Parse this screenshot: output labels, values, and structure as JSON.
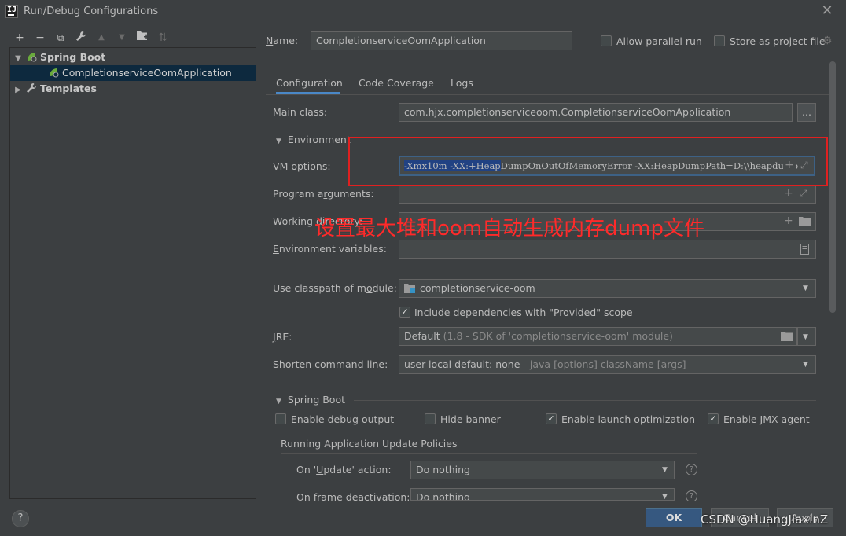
{
  "window": {
    "title": "Run/Debug Configurations",
    "app_icon_text": "IJ"
  },
  "toolbar": {
    "add": "+",
    "remove": "−",
    "copy": "⧉",
    "edit": "🔧",
    "up": "▲",
    "down": "▼",
    "folder": "▣",
    "sort": "⇅"
  },
  "tree": {
    "spring_boot": "Spring Boot",
    "app": "CompletionserviceOomApplication",
    "templates": "Templates"
  },
  "header": {
    "name_label_prefix": "N",
    "name_label_rest": "ame:",
    "name_value": "CompletionserviceOomApplication",
    "parallel_label_a": "Allow parallel r",
    "parallel_label_u": "u",
    "parallel_label_b": "n",
    "store_label_a": "S",
    "store_label_b": "tore as project file"
  },
  "tabs": [
    {
      "label": "Configuration"
    },
    {
      "label": "Code Coverage"
    },
    {
      "label": "Logs"
    }
  ],
  "config": {
    "main_class_label": "Main class:",
    "main_class_value": "com.hjx.completionserviceoom.CompletionserviceOomApplication",
    "browse_button": "...",
    "environment_section": "Environment",
    "vm_label_a": "V",
    "vm_label_b": "M options:",
    "vm_value_selected": "-Xmx10m -XX:+Heap",
    "vm_value_rest": "DumpOnOutOfMemoryError -XX:HeapDumpPath=D:\\\\heapdump",
    "program_args_label_a": "Program a",
    "program_args_label_u": "r",
    "program_args_label_b": "guments:",
    "working_dir_label_a": "W",
    "working_dir_label_b": "orking directory:",
    "env_vars_label_a": "E",
    "env_vars_label_b": "nvironment variables:",
    "classpath_label_a": "Use classpath of m",
    "classpath_label_u": "o",
    "classpath_label_b": "dule:",
    "classpath_value": "completionservice-oom",
    "include_deps_label": "Include dependencies with \"Provided\" scope",
    "jre_label_a": "J",
    "jre_label_b": "RE:",
    "jre_value_main": "Default",
    "jre_value_detail": "(1.8 - SDK of 'completionservice-oom' module)",
    "shorten_label_a": "Shorten command ",
    "shorten_label_u": "l",
    "shorten_label_b": "ine:",
    "shorten_value_main": "user-local default: none",
    "shorten_value_detail": "- java [options] className [args]"
  },
  "spring_boot": {
    "section": "Spring Boot",
    "debug_output_a": "Enable ",
    "debug_output_u": "d",
    "debug_output_b": "ebug output",
    "hide_banner_a": "H",
    "hide_banner_b": "ide banner",
    "launch_opt": "Enable launch optimization",
    "jmx": "Enable JMX agent",
    "policies_title": "Running Application Update Policies",
    "on_update_label_a": "On '",
    "on_update_label_u": "U",
    "on_update_label_b": "pdate' action:",
    "on_update_value": "Do nothing",
    "on_frame_label": "On frame deactivation:",
    "on_frame_value": "Do nothing"
  },
  "state": {
    "allow_parallel": false,
    "store_as_file": false,
    "include_deps": true,
    "debug_output": false,
    "hide_banner": false,
    "launch_optimization": true,
    "jmx_agent": true
  },
  "annotation": {
    "text": "设置最大堆和oom自动生成内存dump文件",
    "color": "#ff2a2a"
  },
  "footer": {
    "ok": "OK",
    "cancel": "Cancel",
    "apply": "Apply",
    "help": "?"
  },
  "watermark": "CSDN @HuangJiaxinZ",
  "colors": {
    "background": "#3c3f41",
    "selection": "#0d293e",
    "accent": "#4a88c7",
    "annotation_red": "#e02020"
  }
}
